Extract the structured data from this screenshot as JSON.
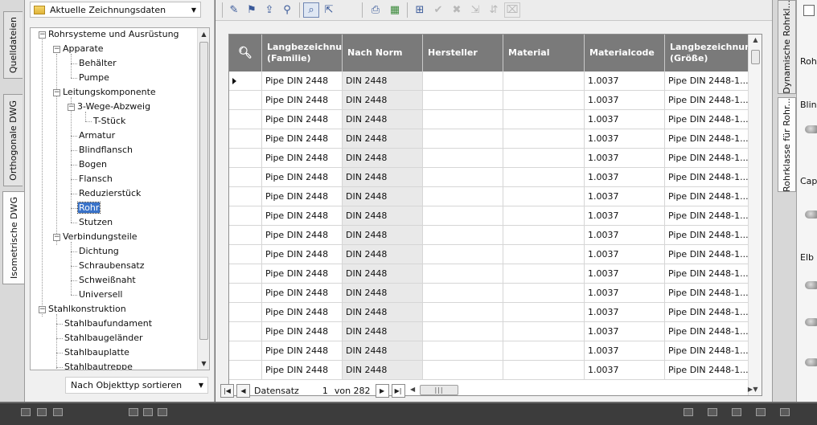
{
  "left_tabs": [
    "Quelldateien",
    "Orthogonale DWG",
    "Isometrische DWG"
  ],
  "left_tabs_active": "Isometrische DWG",
  "datasource": {
    "label": "Aktuelle Zeichnungsdaten"
  },
  "tree": {
    "nodes": [
      {
        "label": "Rohrsysteme und Ausrüstung"
      },
      {
        "label": "Apparate"
      },
      {
        "label": "Behälter"
      },
      {
        "label": "Pumpe"
      },
      {
        "label": "Leitungskomponente"
      },
      {
        "label": "3-Wege-Abzweig"
      },
      {
        "label": "T-Stück"
      },
      {
        "label": "Armatur"
      },
      {
        "label": "Blindflansch"
      },
      {
        "label": "Bogen"
      },
      {
        "label": "Flansch"
      },
      {
        "label": "Reduzierstück"
      },
      {
        "label": "Rohr"
      },
      {
        "label": "Stutzen"
      },
      {
        "label": "Verbindungsteile"
      },
      {
        "label": "Dichtung"
      },
      {
        "label": "Schraubensatz"
      },
      {
        "label": "Schweißnaht"
      },
      {
        "label": "Universell"
      },
      {
        "label": "Stahlkonstruktion"
      },
      {
        "label": "Stahlbaufundament"
      },
      {
        "label": "Stahlbaugeländer"
      },
      {
        "label": "Stahlbauplatte"
      },
      {
        "label": "Stahlbautreppe"
      }
    ],
    "selected": "Rohr"
  },
  "sort": {
    "label": "Nach Objekttyp sortieren"
  },
  "toolbar_icons": [
    "edit-icon",
    "tag-icon",
    "export-icon",
    "filter-icon",
    "zoom-icon",
    "cursor-icon",
    "print-icon",
    "excel-icon",
    "select-icon",
    "check-icon",
    "cross-icon",
    "accept-icon",
    "reject-icon",
    "clear-icon"
  ],
  "grid": {
    "columns": [
      "Langbezeichnung\n(Familie)",
      "Nach Norm",
      "Hersteller",
      "Material",
      "Materialcode",
      "Langbezeichnung\n(Größe)"
    ],
    "rows": [
      [
        "Pipe DIN 2448",
        "DIN 2448",
        "",
        "",
        "1.0037",
        "Pipe DIN 2448-1...."
      ],
      [
        "Pipe DIN 2448",
        "DIN 2448",
        "",
        "",
        "1.0037",
        "Pipe DIN 2448-1...."
      ],
      [
        "Pipe DIN 2448",
        "DIN 2448",
        "",
        "",
        "1.0037",
        "Pipe DIN 2448-1...."
      ],
      [
        "Pipe DIN 2448",
        "DIN 2448",
        "",
        "",
        "1.0037",
        "Pipe DIN 2448-1...."
      ],
      [
        "Pipe DIN 2448",
        "DIN 2448",
        "",
        "",
        "1.0037",
        "Pipe DIN 2448-1...."
      ],
      [
        "Pipe DIN 2448",
        "DIN 2448",
        "",
        "",
        "1.0037",
        "Pipe DIN 2448-1...."
      ],
      [
        "Pipe DIN 2448",
        "DIN 2448",
        "",
        "",
        "1.0037",
        "Pipe DIN 2448-1...."
      ],
      [
        "Pipe DIN 2448",
        "DIN 2448",
        "",
        "",
        "1.0037",
        "Pipe DIN 2448-1...."
      ],
      [
        "Pipe DIN 2448",
        "DIN 2448",
        "",
        "",
        "1.0037",
        "Pipe DIN 2448-1...."
      ],
      [
        "Pipe DIN 2448",
        "DIN 2448",
        "",
        "",
        "1.0037",
        "Pipe DIN 2448-1...."
      ],
      [
        "Pipe DIN 2448",
        "DIN 2448",
        "",
        "",
        "1.0037",
        "Pipe DIN 2448-1...."
      ],
      [
        "Pipe DIN 2448",
        "DIN 2448",
        "",
        "",
        "1.0037",
        "Pipe DIN 2448-1...."
      ],
      [
        "Pipe DIN 2448",
        "DIN 2448",
        "",
        "",
        "1.0037",
        "Pipe DIN 2448-1...."
      ],
      [
        "Pipe DIN 2448",
        "DIN 2448",
        "",
        "",
        "1.0037",
        "Pipe DIN 2448-1...."
      ],
      [
        "Pipe DIN 2448",
        "DIN 2448",
        "",
        "",
        "1.0037",
        "Pipe DIN 2448-1...."
      ],
      [
        "Pipe DIN 2448",
        "DIN 2448",
        "",
        "",
        "1.0037",
        "Pipe DIN 2448-1...."
      ]
    ]
  },
  "navigator": {
    "label": "Datensatz",
    "current": "1",
    "total_label": "von 282"
  },
  "right_tabs": [
    "Dynamische Rohrkl...",
    "Rohrklasse für Rohr..."
  ],
  "right_labels": [
    "Rohr",
    "Blin",
    "Cap",
    "Elb"
  ]
}
